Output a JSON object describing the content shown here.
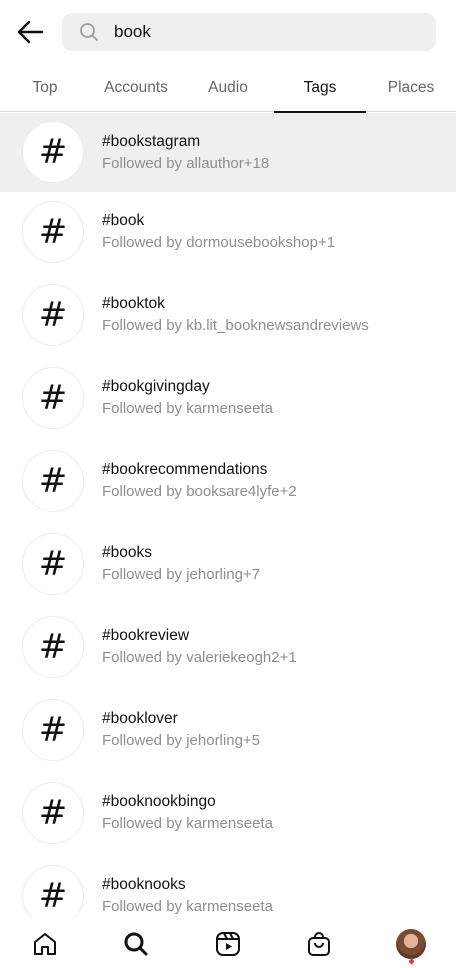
{
  "search": {
    "value": "book",
    "placeholder": "Search"
  },
  "tabs": [
    {
      "label": "Top"
    },
    {
      "label": "Accounts"
    },
    {
      "label": "Audio"
    },
    {
      "label": "Tags"
    },
    {
      "label": "Places"
    }
  ],
  "active_tab": "Tags",
  "results": [
    {
      "tag": "#bookstagram",
      "followed_by": "Followed by allauthor+18"
    },
    {
      "tag": "#book",
      "followed_by": "Followed by dormousebookshop+1"
    },
    {
      "tag": "#booktok",
      "followed_by": "Followed by kb.lit_booknewsandreviews"
    },
    {
      "tag": "#bookgivingday",
      "followed_by": "Followed by karmenseeta"
    },
    {
      "tag": "#bookrecommendations",
      "followed_by": "Followed by booksare4lyfe+2"
    },
    {
      "tag": "#books",
      "followed_by": "Followed by jehorling+7"
    },
    {
      "tag": "#bookreview",
      "followed_by": "Followed by valeriekeogh2+1"
    },
    {
      "tag": "#booklover",
      "followed_by": "Followed by jehorling+5"
    },
    {
      "tag": "#booknookbingo",
      "followed_by": "Followed by karmenseeta"
    },
    {
      "tag": "#booknooks",
      "followed_by": "Followed by karmenseeta"
    }
  ],
  "hash_glyph": "#",
  "icons": {
    "back": "arrow-left-icon",
    "search": "search-icon",
    "home": "home-icon",
    "explore": "search-icon",
    "reels": "reels-icon",
    "shop": "shopping-bag-icon",
    "profile": "profile-avatar"
  },
  "colors": {
    "notification_dot": "#ff3040",
    "highlight_row": "#efefef",
    "secondary_text": "#8e8e8e"
  }
}
